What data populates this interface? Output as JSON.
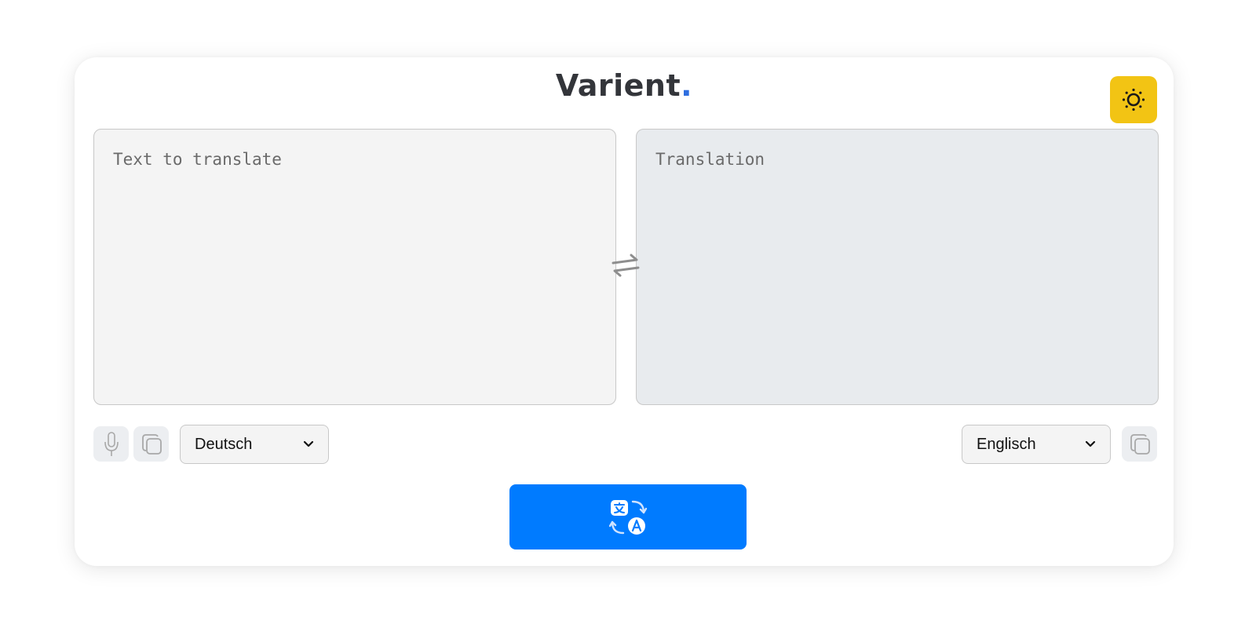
{
  "brand": {
    "name": "Varient",
    "dot": "."
  },
  "source": {
    "placeholder": "Text to translate",
    "language": "Deutsch"
  },
  "target": {
    "placeholder": "Translation",
    "language": "Englisch"
  },
  "icons": {
    "theme": "sun-icon",
    "swap": "swap-arrows-icon",
    "mic": "microphone-icon",
    "copy": "copy-icon",
    "translate": "translate-icon",
    "dropdown": "chevron-down-icon"
  },
  "colors": {
    "accent": "#007bff",
    "theme_button": "#f2c414",
    "brand_dot": "#2f6fe0",
    "source_bg": "#f4f4f4",
    "target_bg": "#e8ebee"
  }
}
